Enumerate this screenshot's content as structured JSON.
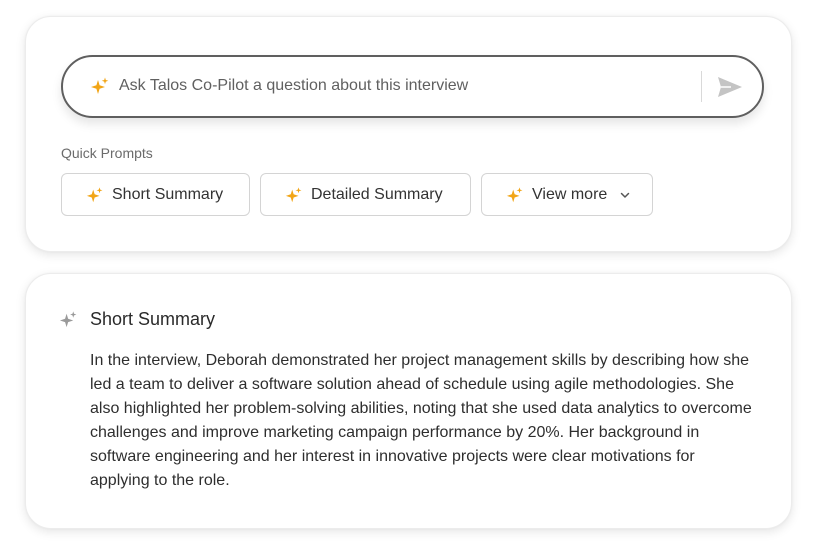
{
  "ask": {
    "placeholder": "Ask Talos Co-Pilot a question about this interview",
    "sparkle_icon": "sparkle-icon",
    "send_icon": "send-icon"
  },
  "quick_prompts": {
    "label": "Quick Prompts",
    "items": [
      {
        "label": "Short Summary",
        "icon": "sparkle-icon"
      },
      {
        "label": "Detailed Summary",
        "icon": "sparkle-icon"
      },
      {
        "label": "View more",
        "icon": "sparkle-icon",
        "trailing_icon": "chevron-down-icon"
      }
    ]
  },
  "summary": {
    "title": "Short Summary",
    "icon": "sparkle-icon",
    "body": "In the interview, Deborah demonstrated her project management skills by describing how she led a team to deliver a software solution ahead of schedule using agile methodologies. She also highlighted her problem-solving abilities, noting that she used data analytics to overcome challenges and improve marketing campaign performance by 20%. Her background in software engineering and her interest in innovative projects were clear motivations for applying to the role."
  },
  "colors": {
    "accent_sparkle": "#F2A516",
    "muted_sparkle": "#9a9a9a",
    "ask_border": "#5f5f5f",
    "send_icon": "#c4c4c4"
  }
}
